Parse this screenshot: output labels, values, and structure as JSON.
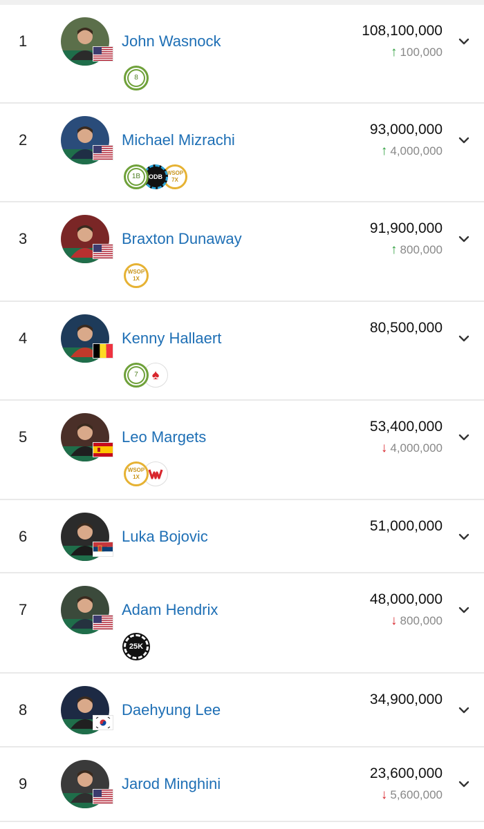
{
  "colors": {
    "name": "#1e6fb5",
    "up": "#2a9d3a",
    "down": "#d8262d",
    "muted": "#888888"
  },
  "players": [
    {
      "rank": "1",
      "name": "John Wasnock",
      "stack": "108,100,000",
      "direction": "up",
      "change": "100,000",
      "flag": "us",
      "badges": [
        {
          "type": "green",
          "label": "8"
        }
      ]
    },
    {
      "rank": "2",
      "name": "Michael Mizrachi",
      "stack": "93,000,000",
      "direction": "up",
      "change": "4,000,000",
      "flag": "us",
      "badges": [
        {
          "type": "green",
          "label": "1B"
        },
        {
          "type": "odb",
          "label": "ODB"
        },
        {
          "type": "wsop",
          "label": "WSOP 7X"
        }
      ]
    },
    {
      "rank": "3",
      "name": "Braxton Dunaway",
      "stack": "91,900,000",
      "direction": "up",
      "change": "800,000",
      "flag": "us",
      "badges": [
        {
          "type": "wsop",
          "label": "WSOP 1X"
        }
      ]
    },
    {
      "rank": "4",
      "name": "Kenny Hallaert",
      "stack": "80,500,000",
      "direction": "",
      "change": "",
      "flag": "be",
      "badges": [
        {
          "type": "green",
          "label": "7"
        },
        {
          "type": "star",
          "label": ""
        }
      ]
    },
    {
      "rank": "5",
      "name": "Leo Margets",
      "stack": "53,400,000",
      "direction": "down",
      "change": "4,000,000",
      "flag": "es",
      "badges": [
        {
          "type": "wsop",
          "label": "WSOP 1X"
        },
        {
          "type": "gg",
          "label": ""
        }
      ]
    },
    {
      "rank": "6",
      "name": "Luka Bojovic",
      "stack": "51,000,000",
      "direction": "",
      "change": "",
      "flag": "rs",
      "badges": []
    },
    {
      "rank": "7",
      "name": "Adam Hendrix",
      "stack": "48,000,000",
      "direction": "down",
      "change": "800,000",
      "flag": "us",
      "badges": [
        {
          "type": "chip",
          "label": "25K"
        }
      ]
    },
    {
      "rank": "8",
      "name": "Daehyung Lee",
      "stack": "34,900,000",
      "direction": "",
      "change": "",
      "flag": "kr",
      "badges": []
    },
    {
      "rank": "9",
      "name": "Jarod Minghini",
      "stack": "23,600,000",
      "direction": "down",
      "change": "5,600,000",
      "flag": "us",
      "badges": []
    }
  ]
}
